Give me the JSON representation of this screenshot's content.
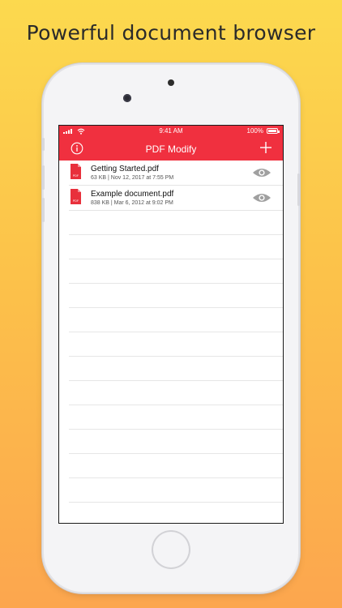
{
  "headline": "Powerful document browser",
  "status_bar": {
    "time": "9:41 AM",
    "battery_percent": "100%",
    "battery_level": 1.0
  },
  "navbar": {
    "title": "PDF Modify"
  },
  "files": [
    {
      "name": "Getting Started.pdf",
      "meta": "63 KB | Nov 12, 2017 at 7:55 PM",
      "icon_label": "PDF"
    },
    {
      "name": "Example document.pdf",
      "meta": "838 KB | Mar 6, 2012 at 9:02 PM",
      "icon_label": "PDF"
    }
  ],
  "colors": {
    "accent": "#F0303F",
    "pdf_icon": "#E8303C",
    "eye_icon": "#A0A0A0"
  },
  "icons": {
    "info": "info-circle-icon",
    "add": "plus-icon",
    "file": "pdf-file-icon",
    "preview": "eye-icon"
  }
}
